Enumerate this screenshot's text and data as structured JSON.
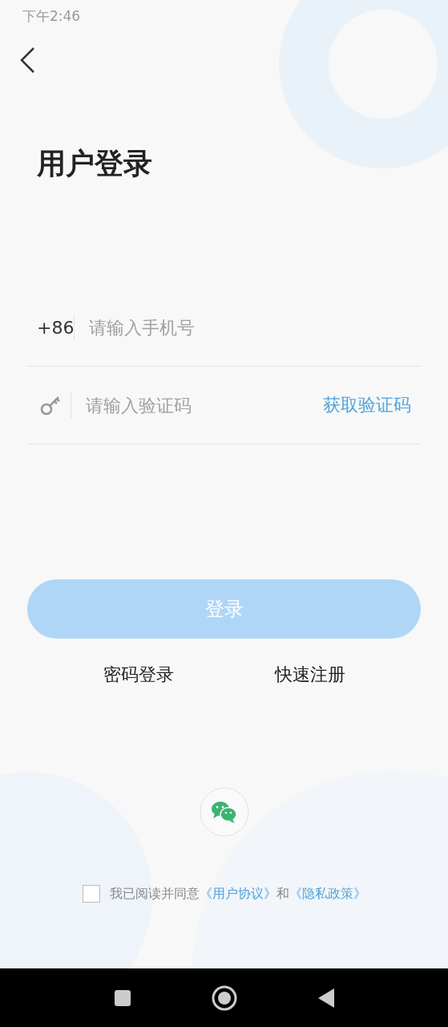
{
  "status_bar": {
    "time": "下午2:46"
  },
  "title": "用户登录",
  "phone": {
    "prefix": "+86",
    "placeholder": "请输入手机号"
  },
  "code": {
    "placeholder": "请输入验证码",
    "action": "获取验证码"
  },
  "login_button": {
    "label": "登录",
    "disabled": true
  },
  "links": [
    "密码登录",
    "快速注册"
  ],
  "agreement": {
    "checked": false,
    "text": "我已阅读并同意",
    "link_1": "《用户协议》",
    "joiner": "和",
    "link_2": "《隐私政策》"
  }
}
